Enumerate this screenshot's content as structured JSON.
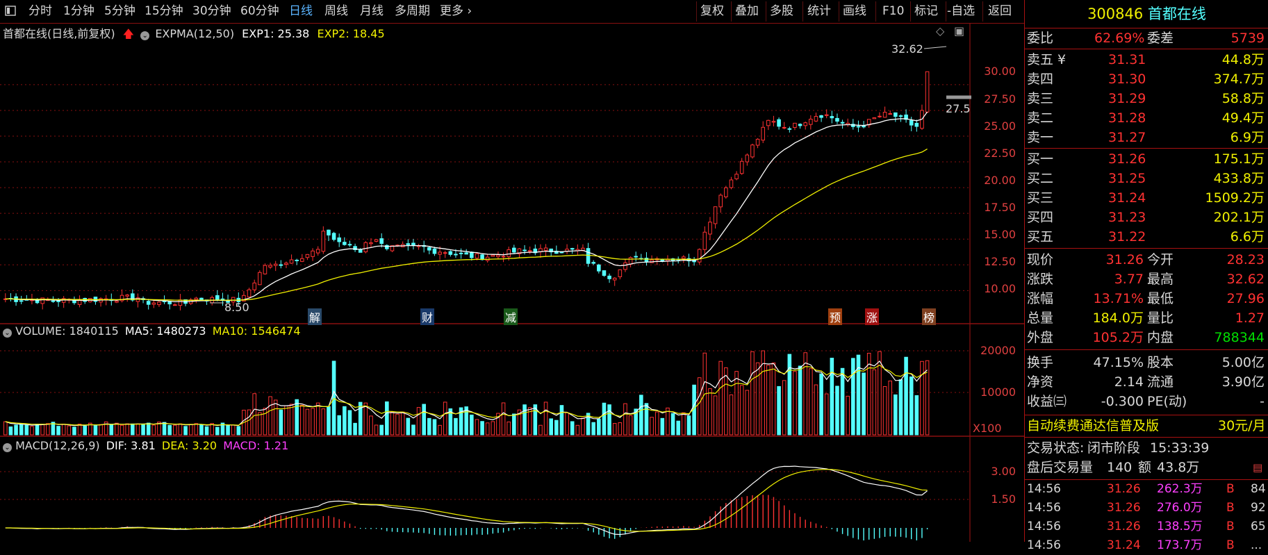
{
  "toolbar": {
    "left": [
      "分时",
      "1分钟",
      "5分钟",
      "15分钟",
      "30分钟",
      "60分钟",
      "日线",
      "周线",
      "月线",
      "多周期",
      "更多 ›"
    ],
    "active": "日线",
    "right": [
      "复权",
      "叠加",
      "多股",
      "统计",
      "画线",
      "F10",
      "标记",
      "-自选",
      "返回"
    ]
  },
  "main_header": {
    "title": "首都在线(日线,前复权)",
    "indicator": "EXPMA(12,50)",
    "exp1": "EXP1: 25.38",
    "exp2": "EXP2: 18.45"
  },
  "vol_header": {
    "name": "VOLUME: 1840115",
    "ma5": "MA5: 1480273",
    "ma10": "MA10: 1546474"
  },
  "macd_header": {
    "name": "MACD(12,26,9)",
    "dif": "DIF: 3.81",
    "dea": "DEA: 3.20",
    "macd": "MACD: 1.21"
  },
  "colors": {
    "up": "#ff3232",
    "down": "#54ffff",
    "exp1": "#ffffff",
    "exp2": "#f0f000",
    "axis": "#e04040",
    "grid": "#8a1010"
  },
  "chart_data": [
    {
      "type": "candlestick",
      "title": "首都在线(日线,前复权)",
      "y_ticks": [
        "30.00",
        "27.50",
        "25.00",
        "22.50",
        "20.00",
        "17.50",
        "15.00",
        "12.50",
        "10.00"
      ],
      "ylim": [
        8.0,
        33.5
      ],
      "annotations": {
        "high": "32.62",
        "low": "8.50",
        "last": "27.5"
      },
      "events": [
        "解",
        "财",
        "减",
        "预",
        "涨",
        "榜"
      ],
      "series": [
        {
          "name": "EXP1"
        },
        {
          "name": "EXP2"
        }
      ],
      "last_bars": [
        {
          "open": 27.96,
          "high": 27.96,
          "low": 26.5,
          "close": 27.5
        },
        {
          "open": 28.23,
          "high": 32.62,
          "low": 27.96,
          "close": 31.26
        }
      ]
    },
    {
      "type": "bar",
      "title": "VOLUME",
      "y_ticks": [
        "20000",
        "10000"
      ],
      "unit_label": "X100",
      "last_value": 1840115,
      "ma5": 1480273,
      "ma10": 1546474
    },
    {
      "type": "bar",
      "title": "MACD(12,26,9)",
      "y_ticks": [
        "3.00",
        "1.50"
      ],
      "dif": 3.81,
      "dea": 3.2,
      "macd": 1.21
    }
  ],
  "quote": {
    "code": "300846",
    "name": "首都在线",
    "weibi_label": "委比",
    "weibi": "62.69%",
    "weicha_label": "委差",
    "weicha": "5739",
    "asks": [
      {
        "label": "卖五 ¥",
        "price": "31.31",
        "vol": "44.8万"
      },
      {
        "label": "卖四",
        "price": "31.30",
        "vol": "374.7万"
      },
      {
        "label": "卖三",
        "price": "31.29",
        "vol": "58.8万"
      },
      {
        "label": "卖二",
        "price": "31.28",
        "vol": "49.4万"
      },
      {
        "label": "卖一",
        "price": "31.27",
        "vol": "6.9万"
      }
    ],
    "bids": [
      {
        "label": "买一",
        "price": "31.26",
        "vol": "175.1万"
      },
      {
        "label": "买二",
        "price": "31.25",
        "vol": "433.8万"
      },
      {
        "label": "买三",
        "price": "31.24",
        "vol": "1509.2万"
      },
      {
        "label": "买四",
        "price": "31.23",
        "vol": "202.1万"
      },
      {
        "label": "买五",
        "price": "31.22",
        "vol": "6.6万"
      }
    ],
    "stats": [
      {
        "l1": "现价",
        "v1": "31.26",
        "c1": "#ff3232",
        "l2": "今开",
        "v2": "28.23",
        "c2": "#ff3232"
      },
      {
        "l1": "涨跌",
        "v1": "3.77",
        "c1": "#ff3232",
        "l2": "最高",
        "v2": "32.62",
        "c2": "#ff3232"
      },
      {
        "l1": "涨幅",
        "v1": "13.71%",
        "c1": "#ff3232",
        "l2": "最低",
        "v2": "27.96",
        "c2": "#ff3232"
      },
      {
        "l1": "总量",
        "v1": "184.0万",
        "c1": "#f0f000",
        "l2": "量比",
        "v2": "1.27",
        "c2": "#ff3232"
      },
      {
        "l1": "外盘",
        "v1": "105.2万",
        "c1": "#ff3232",
        "l2": "内盘",
        "v2": "788344",
        "c2": "#00e000"
      }
    ],
    "stats2": [
      {
        "l1": "换手",
        "v1": "47.15%",
        "l2": "股本",
        "v2": "5.00亿"
      },
      {
        "l1": "净资",
        "v1": "2.14",
        "l2": "流通",
        "v2": "3.90亿"
      },
      {
        "l1": "收益㈢",
        "v1": "-0.300",
        "l2": "PE(动)",
        "v2": "-"
      }
    ],
    "ad_text": "自动续费通达信普及版",
    "ad_price": "30元/月",
    "status_label": "交易状态:",
    "status": "闭市阶段",
    "time": "15:33:39",
    "after_label": "盘后交易量",
    "after_vol": "140",
    "after_amt_label": "额",
    "after_amt": "43.8万",
    "ticks": [
      {
        "t": "14:56",
        "p": "31.26",
        "v": "262.3万",
        "d": "B",
        "n": "84"
      },
      {
        "t": "14:56",
        "p": "31.26",
        "v": "276.0万",
        "d": "B",
        "n": "92"
      },
      {
        "t": "14:56",
        "p": "31.26",
        "v": "138.5万",
        "d": "B",
        "n": "65"
      },
      {
        "t": "14:56",
        "p": "31.24",
        "v": "173.7万",
        "d": "B",
        "n": "..."
      }
    ]
  }
}
